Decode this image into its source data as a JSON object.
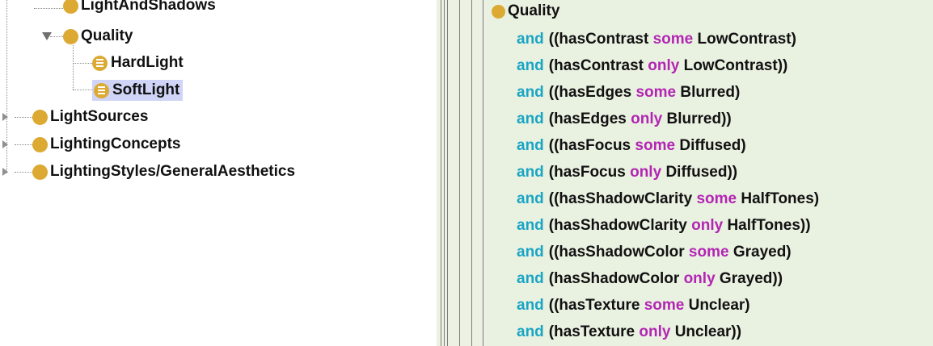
{
  "class_tree": {
    "items": [
      {
        "label": "LightAndShadows",
        "icon": "class-icon",
        "state": "partially-visible"
      },
      {
        "label": "Quality",
        "icon": "class-icon",
        "expanded": true
      },
      {
        "label": "HardLight",
        "icon": "defined-class-icon"
      },
      {
        "label": "SoftLight",
        "icon": "defined-class-icon",
        "selected": true
      },
      {
        "label": "LightSources",
        "icon": "class-icon",
        "expanded": false
      },
      {
        "label": "LightingConcepts",
        "icon": "class-icon",
        "expanded": false
      },
      {
        "label": "LightingStyles/GeneralAesthetics",
        "icon": "class-icon",
        "expanded": false
      }
    ]
  },
  "expression": {
    "head": "Quality",
    "rows": [
      {
        "kw": "and",
        "pre": "((hasContrast",
        "q": "some",
        "post": "LowContrast)"
      },
      {
        "kw": "and",
        "pre": "(hasContrast",
        "q": "only",
        "post": "LowContrast))"
      },
      {
        "kw": "and",
        "pre": "((hasEdges",
        "q": "some",
        "post": "Blurred)"
      },
      {
        "kw": "and",
        "pre": "(hasEdges",
        "q": "only",
        "post": "Blurred))"
      },
      {
        "kw": "and",
        "pre": "((hasFocus",
        "q": "some",
        "post": "Diffused)"
      },
      {
        "kw": "and",
        "pre": "(hasFocus",
        "q": "only",
        "post": "Diffused))"
      },
      {
        "kw": "and",
        "pre": "((hasShadowClarity",
        "q": "some",
        "post": "HalfTones)"
      },
      {
        "kw": "and",
        "pre": "(hasShadowClarity",
        "q": "only",
        "post": "HalfTones))"
      },
      {
        "kw": "and",
        "pre": "((hasShadowColor",
        "q": "some",
        "post": "Grayed)"
      },
      {
        "kw": "and",
        "pre": "(hasShadowColor",
        "q": "only",
        "post": "Grayed))"
      },
      {
        "kw": "and",
        "pre": "((hasTexture",
        "q": "some",
        "post": "Unclear)"
      },
      {
        "kw": "and",
        "pre": "(hasTexture",
        "q": "only",
        "post": "Unclear))"
      }
    ]
  },
  "colors": {
    "class_icon": "#dcaa33",
    "selection": "#d0d4f6",
    "keyword_and": "#1aa5c4",
    "keyword_quantifier": "#b325b3",
    "panel_background": "#e9f1e1"
  }
}
